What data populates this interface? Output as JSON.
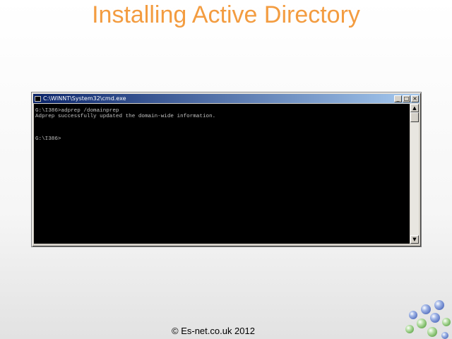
{
  "slide": {
    "title": "Installing Active Directory",
    "footer": "© Es-net.co.uk 2012"
  },
  "window": {
    "title": "C:\\WINNT\\System32\\cmd.exe",
    "buttons": {
      "minimize": "_",
      "maximize": "□",
      "close": "×"
    }
  },
  "console": {
    "lines": [
      "G:\\I386>adprep /domainprep",
      "Adprep successfully updated the domain-wide information.",
      "",
      "",
      "",
      "G:\\I386>"
    ]
  },
  "scrollbar": {
    "up": "▲",
    "down": "▼"
  },
  "colors": {
    "title": "#f39c40",
    "titlebar_start": "#0a246a",
    "titlebar_end": "#a6caf0",
    "console_bg": "#000000",
    "console_text": "#c0c0c0"
  }
}
